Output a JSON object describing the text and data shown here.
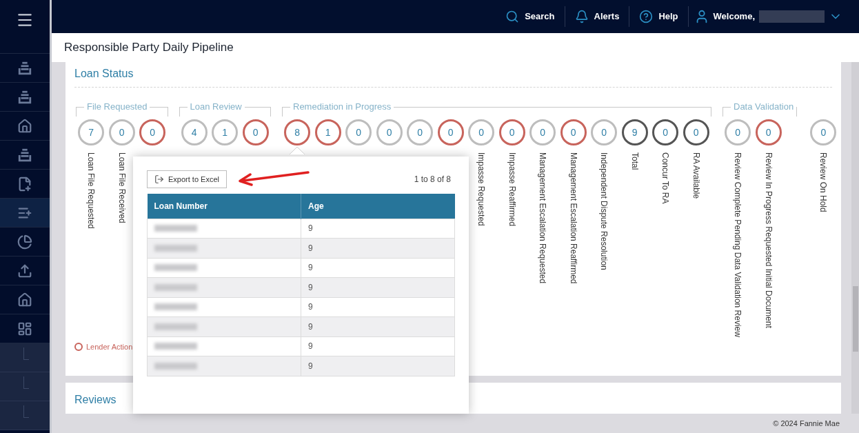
{
  "top_bar": {
    "items": [
      {
        "kind": "search",
        "label": "Search"
      },
      {
        "kind": "alerts",
        "label": "Alerts"
      },
      {
        "kind": "help",
        "label": "Help"
      }
    ],
    "welcome": "Welcome,"
  },
  "sidebar": {
    "items": [
      {
        "selected": false
      },
      {
        "selected": false
      },
      {
        "selected": false
      },
      {
        "selected": false
      },
      {
        "selected": false
      },
      {
        "selected": true
      },
      {
        "selected": false
      },
      {
        "selected": false
      },
      {
        "selected": false
      },
      {
        "selected": false
      }
    ],
    "sub_items": [
      {
        "selected": false
      },
      {
        "selected": false
      },
      {
        "selected": false
      }
    ]
  },
  "page_title": "Responsible Party Daily Pipeline",
  "loan_status": {
    "title": "Loan Status",
    "groups": [
      {
        "title": "File Requested",
        "counters": [
          {
            "value": "7",
            "kind": "normal",
            "label": "Loan File Requested"
          },
          {
            "value": "0",
            "kind": "normal",
            "label": "Loan File Received"
          },
          {
            "value": "0",
            "kind": "lender"
          }
        ]
      },
      {
        "title": "Loan Review",
        "counters": [
          {
            "value": "4",
            "kind": "normal"
          },
          {
            "value": "1",
            "kind": "normal"
          },
          {
            "value": "0",
            "kind": "lender"
          }
        ]
      },
      {
        "title": "Remediation in Progress",
        "counters": [
          {
            "value": "8",
            "kind": "lender",
            "selected": true
          },
          {
            "value": "1",
            "kind": "lender"
          },
          {
            "value": "0",
            "kind": "normal"
          },
          {
            "value": "0",
            "kind": "normal"
          },
          {
            "value": "0",
            "kind": "normal"
          },
          {
            "value": "0",
            "kind": "lender"
          },
          {
            "value": "0",
            "kind": "normal",
            "label": "Impasse Requested"
          },
          {
            "value": "0",
            "kind": "lender",
            "label": "Impasse Reaffirmed"
          },
          {
            "value": "0",
            "kind": "normal",
            "label": "Management Escalation Requested"
          },
          {
            "value": "0",
            "kind": "lender",
            "label": "Management Escalation Reaffirmed"
          },
          {
            "value": "0",
            "kind": "normal",
            "label": "Independent Dispute Resolution"
          },
          {
            "value": "9",
            "kind": "total",
            "label": "Total"
          },
          {
            "value": "0",
            "kind": "total",
            "label": "Concur To RA"
          },
          {
            "value": "0",
            "kind": "total",
            "label": "RA Available"
          }
        ]
      },
      {
        "title": "Data Validation",
        "counters": [
          {
            "value": "0",
            "kind": "normal",
            "label": "Review Complete Pending Data Validation Review"
          },
          {
            "value": "0",
            "kind": "lender",
            "label": "Review In Progress Requested Initial Document"
          }
        ]
      },
      {
        "counters": [
          {
            "value": "0",
            "kind": "normal",
            "label": "Review On Hold"
          }
        ]
      }
    ],
    "legend": "Lender Action"
  },
  "popup": {
    "export_button": "Export to Excel",
    "count": "1 to 8 of 8",
    "columns": [
      "Loan Number",
      "Age"
    ],
    "rows": [
      {
        "age": "9"
      },
      {
        "age": "9"
      },
      {
        "age": "9"
      },
      {
        "age": "9"
      },
      {
        "age": "9"
      },
      {
        "age": "9"
      },
      {
        "age": "9"
      },
      {
        "age": "9"
      }
    ]
  },
  "reviews": {
    "title": "Reviews"
  },
  "footer": "© 2024 Fannie Mae"
}
